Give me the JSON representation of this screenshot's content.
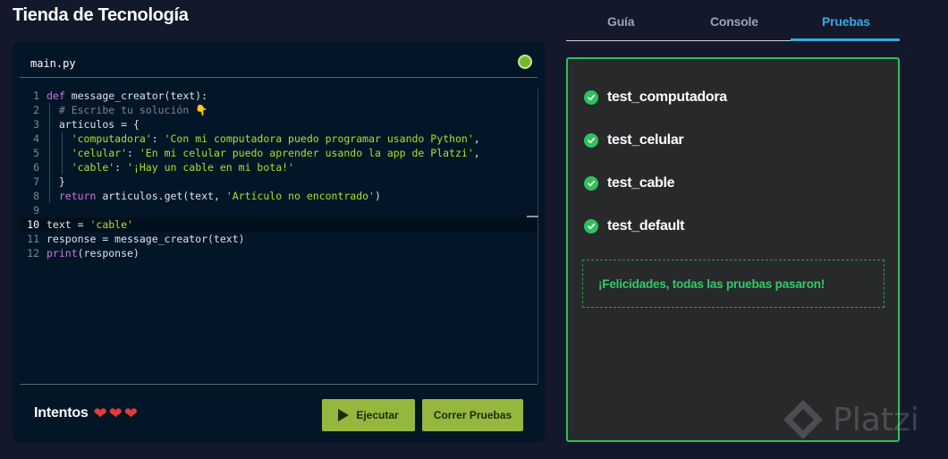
{
  "page": {
    "title": "Tienda de Tecnología"
  },
  "editor": {
    "filename": "main.py",
    "lines": [
      {
        "n": "1",
        "indent": 0,
        "tokens": [
          {
            "t": "kw",
            "v": "def "
          },
          {
            "t": "fn",
            "v": "message_creator(text):"
          }
        ]
      },
      {
        "n": "2",
        "indent": 1,
        "tokens": [
          {
            "t": "cm",
            "v": "# Escribe tu solución 👇"
          }
        ]
      },
      {
        "n": "3",
        "indent": 1,
        "tokens": [
          {
            "t": "id",
            "v": "articulos = {"
          }
        ]
      },
      {
        "n": "4",
        "indent": 2,
        "tokens": [
          {
            "t": "str",
            "v": "'computadora'"
          },
          {
            "t": "id",
            "v": ": "
          },
          {
            "t": "str",
            "v": "'Con mi computadora puedo programar usando Python'"
          },
          {
            "t": "id",
            "v": ","
          }
        ]
      },
      {
        "n": "5",
        "indent": 2,
        "tokens": [
          {
            "t": "str",
            "v": "'celular'"
          },
          {
            "t": "id",
            "v": ": "
          },
          {
            "t": "str",
            "v": "'En mi celular puedo aprender usando la app de Platzi'"
          },
          {
            "t": "id",
            "v": ","
          }
        ]
      },
      {
        "n": "6",
        "indent": 2,
        "tokens": [
          {
            "t": "str",
            "v": "'cable'"
          },
          {
            "t": "id",
            "v": ": "
          },
          {
            "t": "str",
            "v": "'¡Hay un cable en mi bota!'"
          }
        ]
      },
      {
        "n": "7",
        "indent": 1,
        "tokens": [
          {
            "t": "id",
            "v": "}"
          }
        ]
      },
      {
        "n": "8",
        "indent": 1,
        "tokens": [
          {
            "t": "kw",
            "v": "return "
          },
          {
            "t": "id",
            "v": "articulos.get(text, "
          },
          {
            "t": "str",
            "v": "'Artículo no encontrado'"
          },
          {
            "t": "id",
            "v": ")"
          }
        ]
      },
      {
        "n": "9",
        "indent": 0,
        "tokens": []
      },
      {
        "n": "10",
        "indent": 0,
        "active": true,
        "tokens": [
          {
            "t": "id",
            "v": "text = "
          },
          {
            "t": "str",
            "v": "'cable'"
          }
        ]
      },
      {
        "n": "11",
        "indent": 0,
        "tokens": [
          {
            "t": "id",
            "v": "response = message_creator(text)"
          }
        ]
      },
      {
        "n": "12",
        "indent": 0,
        "tokens": [
          {
            "t": "kw",
            "v": "print"
          },
          {
            "t": "id",
            "v": "(response)"
          }
        ]
      }
    ]
  },
  "footer": {
    "attempts_label": "Intentos",
    "hearts": [
      "❤",
      "❤",
      "❤"
    ],
    "run_label": "Ejecutar",
    "tests_label": "Correr Pruebas"
  },
  "tabs": {
    "guide": "Guía",
    "console": "Console",
    "tests": "Pruebas",
    "active": "tests"
  },
  "results": {
    "tests": [
      "test_computadora",
      "test_celular",
      "test_cable",
      "test_default"
    ],
    "message": "¡Felicidades, todas las pruebas pasaron!"
  },
  "watermark": {
    "text": "Platzi"
  },
  "colors": {
    "accent_green": "#27c25b",
    "tab_active": "#36a9e1",
    "button": "#94b73d",
    "heart": "#e53a3a"
  }
}
